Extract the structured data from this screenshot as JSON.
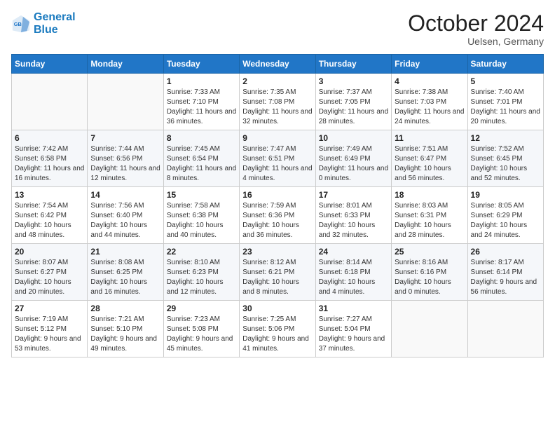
{
  "header": {
    "logo_line1": "General",
    "logo_line2": "Blue",
    "month": "October 2024",
    "location": "Uelsen, Germany"
  },
  "days_of_week": [
    "Sunday",
    "Monday",
    "Tuesday",
    "Wednesday",
    "Thursday",
    "Friday",
    "Saturday"
  ],
  "weeks": [
    [
      {
        "day": "",
        "text": ""
      },
      {
        "day": "",
        "text": ""
      },
      {
        "day": "1",
        "text": "Sunrise: 7:33 AM\nSunset: 7:10 PM\nDaylight: 11 hours and 36 minutes."
      },
      {
        "day": "2",
        "text": "Sunrise: 7:35 AM\nSunset: 7:08 PM\nDaylight: 11 hours and 32 minutes."
      },
      {
        "day": "3",
        "text": "Sunrise: 7:37 AM\nSunset: 7:05 PM\nDaylight: 11 hours and 28 minutes."
      },
      {
        "day": "4",
        "text": "Sunrise: 7:38 AM\nSunset: 7:03 PM\nDaylight: 11 hours and 24 minutes."
      },
      {
        "day": "5",
        "text": "Sunrise: 7:40 AM\nSunset: 7:01 PM\nDaylight: 11 hours and 20 minutes."
      }
    ],
    [
      {
        "day": "6",
        "text": "Sunrise: 7:42 AM\nSunset: 6:58 PM\nDaylight: 11 hours and 16 minutes."
      },
      {
        "day": "7",
        "text": "Sunrise: 7:44 AM\nSunset: 6:56 PM\nDaylight: 11 hours and 12 minutes."
      },
      {
        "day": "8",
        "text": "Sunrise: 7:45 AM\nSunset: 6:54 PM\nDaylight: 11 hours and 8 minutes."
      },
      {
        "day": "9",
        "text": "Sunrise: 7:47 AM\nSunset: 6:51 PM\nDaylight: 11 hours and 4 minutes."
      },
      {
        "day": "10",
        "text": "Sunrise: 7:49 AM\nSunset: 6:49 PM\nDaylight: 11 hours and 0 minutes."
      },
      {
        "day": "11",
        "text": "Sunrise: 7:51 AM\nSunset: 6:47 PM\nDaylight: 10 hours and 56 minutes."
      },
      {
        "day": "12",
        "text": "Sunrise: 7:52 AM\nSunset: 6:45 PM\nDaylight: 10 hours and 52 minutes."
      }
    ],
    [
      {
        "day": "13",
        "text": "Sunrise: 7:54 AM\nSunset: 6:42 PM\nDaylight: 10 hours and 48 minutes."
      },
      {
        "day": "14",
        "text": "Sunrise: 7:56 AM\nSunset: 6:40 PM\nDaylight: 10 hours and 44 minutes."
      },
      {
        "day": "15",
        "text": "Sunrise: 7:58 AM\nSunset: 6:38 PM\nDaylight: 10 hours and 40 minutes."
      },
      {
        "day": "16",
        "text": "Sunrise: 7:59 AM\nSunset: 6:36 PM\nDaylight: 10 hours and 36 minutes."
      },
      {
        "day": "17",
        "text": "Sunrise: 8:01 AM\nSunset: 6:33 PM\nDaylight: 10 hours and 32 minutes."
      },
      {
        "day": "18",
        "text": "Sunrise: 8:03 AM\nSunset: 6:31 PM\nDaylight: 10 hours and 28 minutes."
      },
      {
        "day": "19",
        "text": "Sunrise: 8:05 AM\nSunset: 6:29 PM\nDaylight: 10 hours and 24 minutes."
      }
    ],
    [
      {
        "day": "20",
        "text": "Sunrise: 8:07 AM\nSunset: 6:27 PM\nDaylight: 10 hours and 20 minutes."
      },
      {
        "day": "21",
        "text": "Sunrise: 8:08 AM\nSunset: 6:25 PM\nDaylight: 10 hours and 16 minutes."
      },
      {
        "day": "22",
        "text": "Sunrise: 8:10 AM\nSunset: 6:23 PM\nDaylight: 10 hours and 12 minutes."
      },
      {
        "day": "23",
        "text": "Sunrise: 8:12 AM\nSunset: 6:21 PM\nDaylight: 10 hours and 8 minutes."
      },
      {
        "day": "24",
        "text": "Sunrise: 8:14 AM\nSunset: 6:18 PM\nDaylight: 10 hours and 4 minutes."
      },
      {
        "day": "25",
        "text": "Sunrise: 8:16 AM\nSunset: 6:16 PM\nDaylight: 10 hours and 0 minutes."
      },
      {
        "day": "26",
        "text": "Sunrise: 8:17 AM\nSunset: 6:14 PM\nDaylight: 9 hours and 56 minutes."
      }
    ],
    [
      {
        "day": "27",
        "text": "Sunrise: 7:19 AM\nSunset: 5:12 PM\nDaylight: 9 hours and 53 minutes."
      },
      {
        "day": "28",
        "text": "Sunrise: 7:21 AM\nSunset: 5:10 PM\nDaylight: 9 hours and 49 minutes."
      },
      {
        "day": "29",
        "text": "Sunrise: 7:23 AM\nSunset: 5:08 PM\nDaylight: 9 hours and 45 minutes."
      },
      {
        "day": "30",
        "text": "Sunrise: 7:25 AM\nSunset: 5:06 PM\nDaylight: 9 hours and 41 minutes."
      },
      {
        "day": "31",
        "text": "Sunrise: 7:27 AM\nSunset: 5:04 PM\nDaylight: 9 hours and 37 minutes."
      },
      {
        "day": "",
        "text": ""
      },
      {
        "day": "",
        "text": ""
      }
    ]
  ]
}
